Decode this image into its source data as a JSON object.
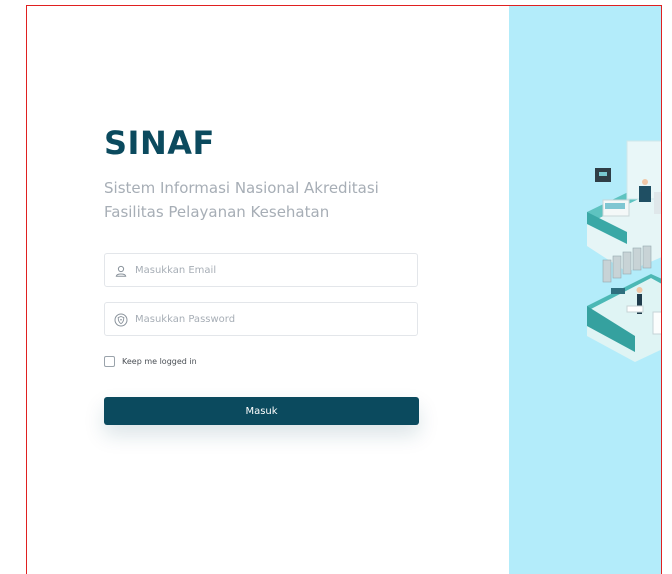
{
  "brand": {
    "title": "SINAF",
    "subtitle": "Sistem Informasi Nasional Akreditasi Fasilitas Pelayanan Kesehatan"
  },
  "form": {
    "email": {
      "placeholder": "Masukkan Email",
      "value": "",
      "icon": "user-icon"
    },
    "password": {
      "placeholder": "Masukkan Password",
      "value": "",
      "icon": "shield-icon"
    },
    "remember": {
      "label": "Keep me logged in",
      "checked": false
    },
    "submit_label": "Masuk"
  },
  "colors": {
    "primary": "#0b4a5e",
    "panel_bg": "#b3ecfa",
    "muted_text": "#a7aeb6",
    "frame_border": "#e02020"
  },
  "illustration": {
    "subject": "isometric hospital rooms"
  }
}
